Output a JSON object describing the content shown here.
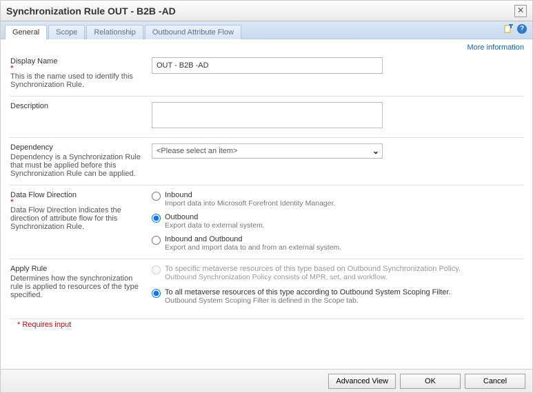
{
  "window": {
    "title": "Synchronization Rule OUT - B2B -AD"
  },
  "tabs": {
    "t0": "General",
    "t1": "Scope",
    "t2": "Relationship",
    "t3": "Outbound Attribute Flow"
  },
  "moreInfo": "More information",
  "displayName": {
    "label": "Display Name",
    "desc": "This is the name used to identify this Synchronization Rule.",
    "value": "OUT - B2B -AD"
  },
  "description": {
    "label": "Description",
    "value": ""
  },
  "dependency": {
    "label": "Dependency",
    "desc": "Dependency is a Synchronization Rule that must be applied before this Synchronization Rule can be applied.",
    "placeholder": "<Please select an item>"
  },
  "dataFlow": {
    "label": "Data Flow Direction",
    "desc": "Data Flow Direction indicates the direction of attribute flow for this Synchronization Rule.",
    "inbound": {
      "title": "Inbound",
      "desc": "Import data into Microsoft Forefront Identity Manager."
    },
    "outbound": {
      "title": "Outbound",
      "desc": "Export data to external system."
    },
    "both": {
      "title": "Inbound and Outbound",
      "desc": "Export and import data to and from an external system."
    }
  },
  "applyRule": {
    "label": "Apply Rule",
    "desc": "Determines how the synchronization rule is applied to resources of the type specified.",
    "specific": {
      "title": "To specific metaverse resources of this type based on Outbound Synchronization Policy.",
      "desc": "Outbound Synchronization Policy consists of MPR, set, and workflow."
    },
    "all": {
      "title": "To all metaverse resources of this type according to Outbound System Scoping Filter.",
      "desc": "Outbound System Scoping Filter is defined in the Scope tab."
    }
  },
  "requiresNote": "* Requires input",
  "buttons": {
    "advanced": "Advanced View",
    "ok": "OK",
    "cancel": "Cancel"
  }
}
